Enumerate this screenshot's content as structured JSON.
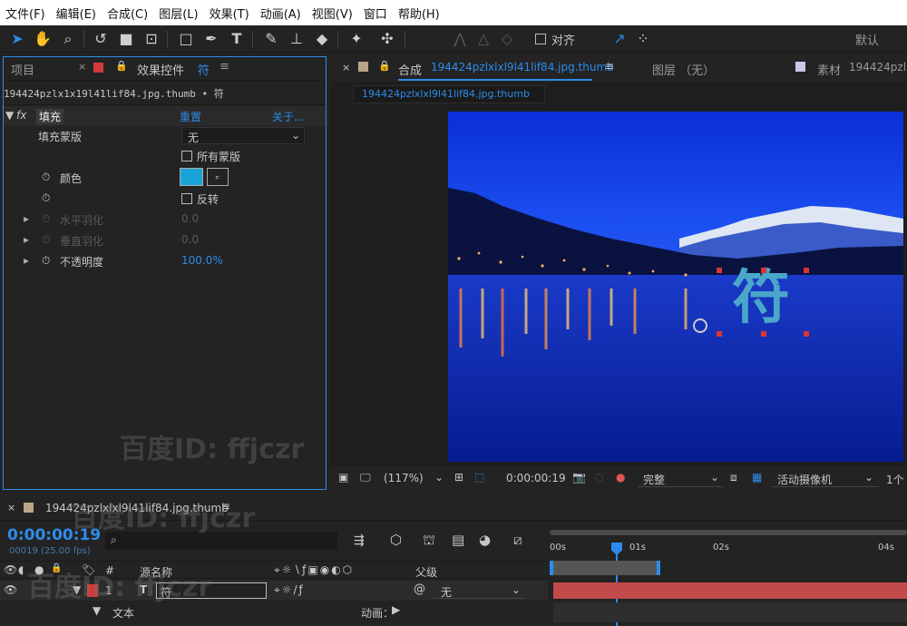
{
  "menu": {
    "items": [
      "文件(F)",
      "编辑(E)",
      "合成(C)",
      "图层(L)",
      "效果(T)",
      "动画(A)",
      "视图(V)",
      "窗口",
      "帮助(H)"
    ]
  },
  "toolbar": {
    "align_label": "对齐",
    "workspace_label": "默认"
  },
  "left_panel": {
    "tab_project": "项目",
    "tab_effects": "效果控件",
    "tab_effects_target": "符",
    "source_line": "194424pzlx1x19l41lif84.jpg.thumb • 符",
    "effect": {
      "fx": "fx",
      "name": "填充",
      "reset": "重置",
      "about": "关于...",
      "mask_label": "填充蒙版",
      "mask_value": "无",
      "all_masks": "所有蒙版",
      "color_label": "颜色",
      "color_value": "#1aa5d8",
      "invert": "反转",
      "h_feather": "水平羽化",
      "h_feather_value": "0.0",
      "v_feather": "垂直羽化",
      "v_feather_value": "0.0",
      "opacity_label": "不透明度",
      "opacity_value": "100.0%"
    }
  },
  "viewer": {
    "tab_comp_prefix": "合成",
    "tab_comp_name": "194424pzlxlxl9l41lif84.jpg.thumb",
    "tab_layer": "图层 （无）",
    "tab_footage_prefix": "素材",
    "tab_footage_name": "194424pzl",
    "breadcrumb": "194424pzlxlxl9l41lif84.jpg.thumb",
    "overlay_text": "符",
    "zoom": "(117%)",
    "timecode": "0:00:00:19",
    "resolution": "完整",
    "camera": "活动摄像机",
    "view_count": "1个"
  },
  "timeline": {
    "tab_name": "194424pzlxlxl9l41lif84.jpg.thumb",
    "current_time": "0:00:00:19",
    "frame_info": "00019 (25.00 fps)",
    "search_placeholder": "",
    "col_hash": "#",
    "col_source": "源名称",
    "col_parent": "父级",
    "ruler": [
      "00s",
      "01s",
      "02s",
      "04s"
    ],
    "layer_index": "1",
    "layer_name": "符",
    "layer_parent": "无",
    "text_label": "文本",
    "animate_label": "动画："
  },
  "watermark": "百度ID: ffjczr"
}
